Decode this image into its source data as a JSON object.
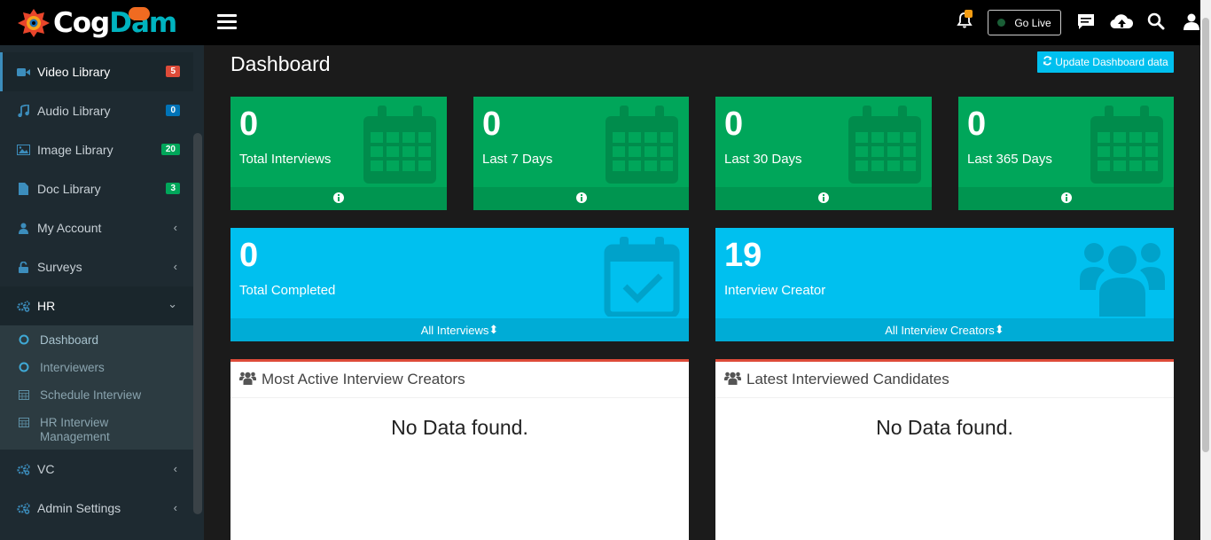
{
  "brand": {
    "part1": "Cog",
    "part2": "Dam"
  },
  "sidebar": {
    "items": [
      {
        "label": "Video Library",
        "badge": "5",
        "badge_color": "#dd4b39"
      },
      {
        "label": "Audio Library",
        "badge": "0",
        "badge_color": "#0073b7"
      },
      {
        "label": "Image Library",
        "badge": "20",
        "badge_color": "#00a65a"
      },
      {
        "label": "Doc Library",
        "badge": "3",
        "badge_color": "#00a65a"
      },
      {
        "label": "My Account"
      },
      {
        "label": "Surveys"
      },
      {
        "label": "HR"
      },
      {
        "label": "VC"
      },
      {
        "label": "Admin Settings"
      }
    ],
    "hr_submenu": [
      "Dashboard",
      "Interviewers",
      "Schedule Interview",
      "HR Interview Management"
    ]
  },
  "topbar": {
    "golive_label": "Go Live"
  },
  "main": {
    "title": "Dashboard",
    "update_button": "Update Dashboard data",
    "stats": [
      {
        "value": "0",
        "label": "Total Interviews"
      },
      {
        "value": "0",
        "label": "Last 7 Days"
      },
      {
        "value": "0",
        "label": "Last 30 Days"
      },
      {
        "value": "0",
        "label": "Last 365 Days"
      }
    ],
    "completed": {
      "value": "0",
      "label": "Total Completed",
      "footer": "All Interviews"
    },
    "creators": {
      "value": "19",
      "label": "Interview Creator",
      "footer": "All Interview Creators"
    },
    "panels": [
      {
        "title": "Most Active Interview Creators",
        "empty": "No Data found."
      },
      {
        "title": "Latest Interviewed Candidates",
        "empty": "No Data found."
      }
    ]
  },
  "colors": {
    "green": "#00a65a",
    "aqua": "#00c0ef",
    "sidebar": "#1e2a31",
    "accent_red": "#dd4b39"
  }
}
